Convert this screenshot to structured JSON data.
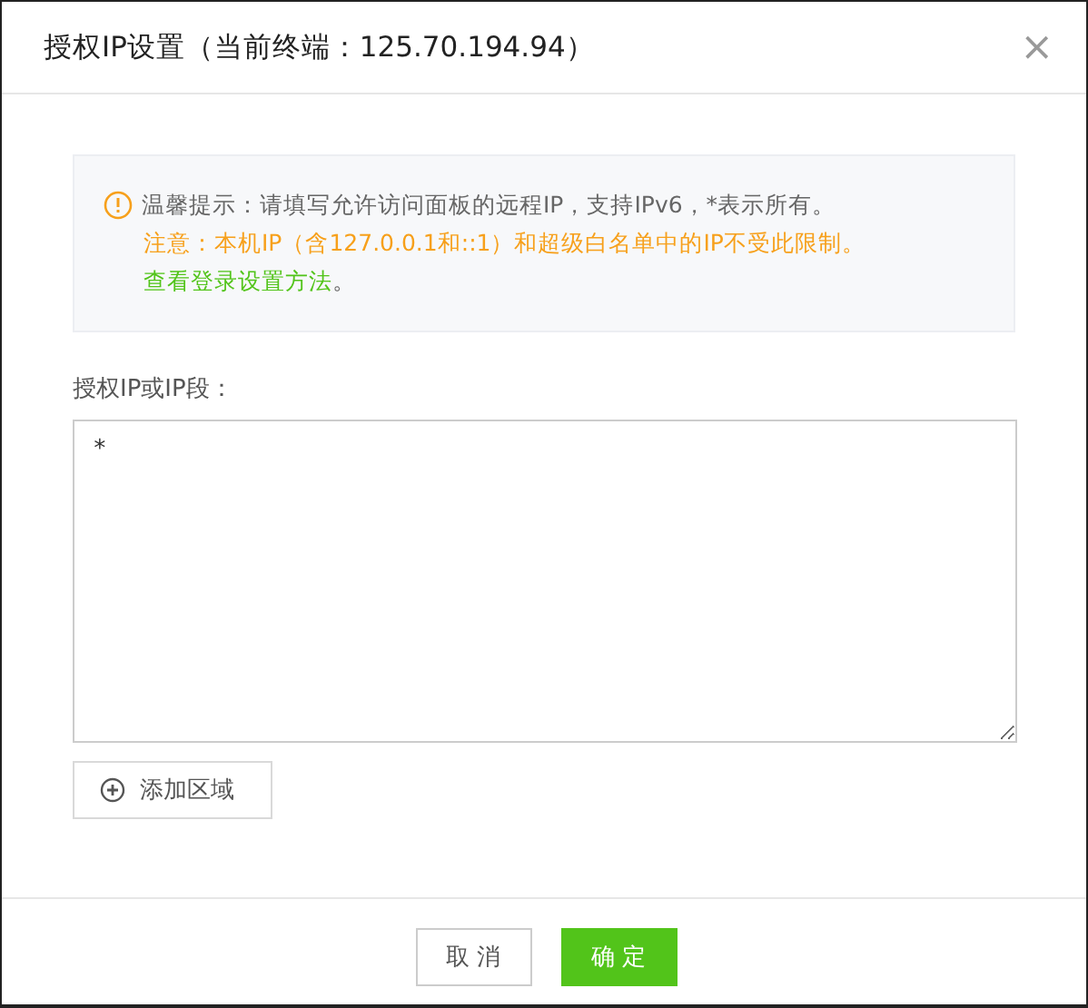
{
  "dialog": {
    "title": "授权IP设置（当前终端：125.70.194.94）",
    "close": "×"
  },
  "notice": {
    "lines": [
      {
        "kind": "tip",
        "text": "温馨提示：请填写允许访问面板的远程IP，支持IPv6，*表示所有。"
      },
      {
        "kind": "warning",
        "text": "注意：本机IP（含127.0.0.1和::1）和超级白名单中的IP不受此限制。"
      },
      {
        "kind": "link",
        "text": "查看登录设置方法",
        "suffix": "。"
      }
    ]
  },
  "field": {
    "label": "授权IP或IP段：",
    "value": "*"
  },
  "add_button": "添加区域",
  "buttons": [
    {
      "kind": "default",
      "label": "取 消"
    },
    {
      "kind": "primary",
      "label": "确 定"
    }
  ]
}
